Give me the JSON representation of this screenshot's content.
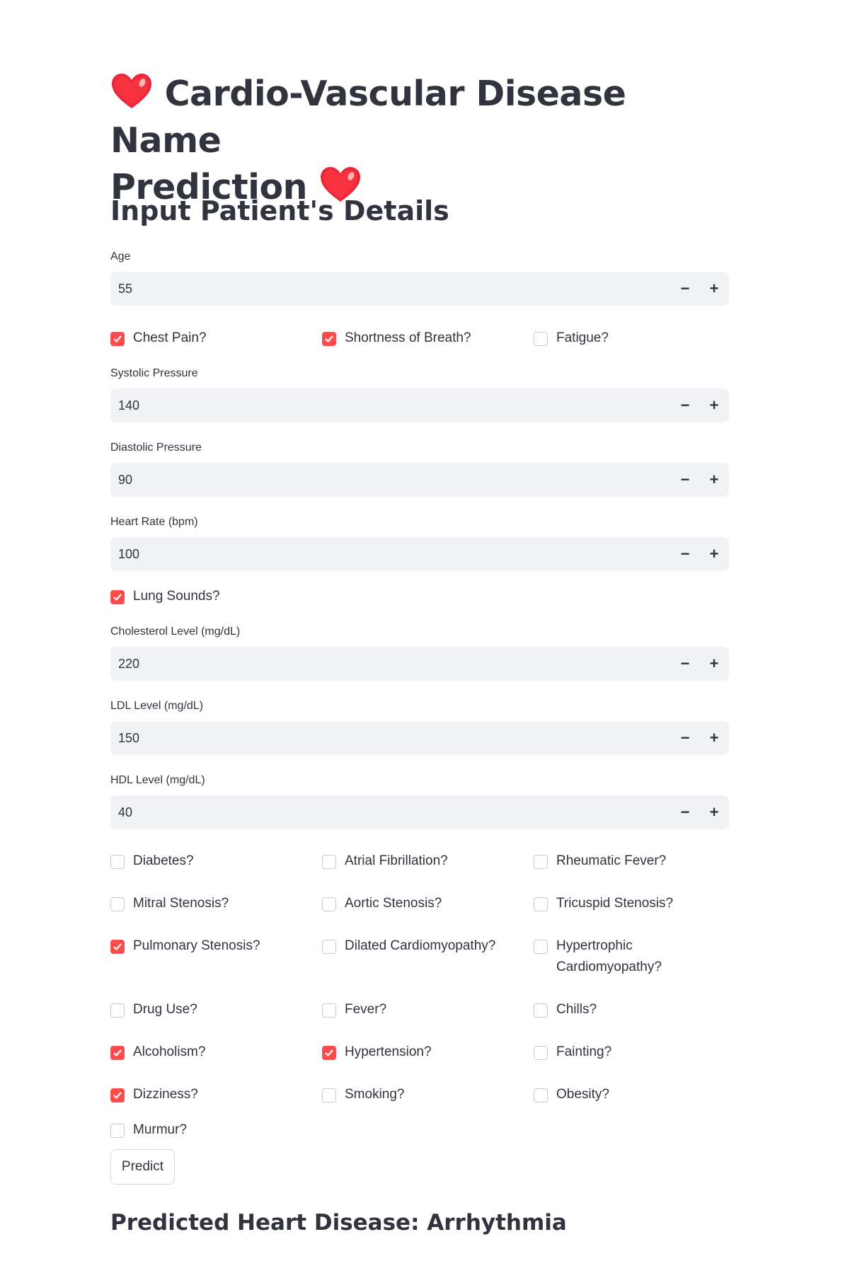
{
  "colors": {
    "accent": "#ff4b4b",
    "text": "#31333f",
    "input_bg": "#f0f2f6"
  },
  "title": {
    "line1": "Cardio-Vascular Disease Name",
    "line2": "Prediction",
    "icon": "red-heart-emoji"
  },
  "subtitle": "Input Patient's Details",
  "inputs": {
    "age": {
      "label": "Age",
      "value": "55"
    },
    "systolic": {
      "label": "Systolic Pressure",
      "value": "140"
    },
    "diastolic": {
      "label": "Diastolic Pressure",
      "value": "90"
    },
    "heart_rate": {
      "label": "Heart Rate (bpm)",
      "value": "100"
    },
    "cholesterol": {
      "label": "Cholesterol Level (mg/dL)",
      "value": "220"
    },
    "ldl": {
      "label": "LDL Level (mg/dL)",
      "value": "150"
    },
    "hdl": {
      "label": "HDL Level (mg/dL)",
      "value": "40"
    }
  },
  "stepper": {
    "minus": "−",
    "plus": "+"
  },
  "checkboxes": {
    "chest_pain": {
      "label": "Chest Pain?",
      "checked": true
    },
    "shortness_of_breath": {
      "label": "Shortness of Breath?",
      "checked": true
    },
    "fatigue": {
      "label": "Fatigue?",
      "checked": false
    },
    "lung_sounds": {
      "label": "Lung Sounds?",
      "checked": true
    },
    "diabetes": {
      "label": "Diabetes?",
      "checked": false
    },
    "atrial_fibrillation": {
      "label": "Atrial Fibrillation?",
      "checked": false
    },
    "rheumatic_fever": {
      "label": "Rheumatic Fever?",
      "checked": false
    },
    "mitral_stenosis": {
      "label": "Mitral Stenosis?",
      "checked": false
    },
    "aortic_stenosis": {
      "label": "Aortic Stenosis?",
      "checked": false
    },
    "tricuspid_stenosis": {
      "label": "Tricuspid Stenosis?",
      "checked": false
    },
    "pulmonary_stenosis": {
      "label": "Pulmonary Stenosis?",
      "checked": true
    },
    "dilated_cardiomyopathy": {
      "label": "Dilated Cardiomyopathy?",
      "checked": false
    },
    "hypertrophic_cardiomyopathy": {
      "label": "Hypertrophic Cardiomyopathy?",
      "checked": false
    },
    "drug_use": {
      "label": "Drug Use?",
      "checked": false
    },
    "fever": {
      "label": "Fever?",
      "checked": false
    },
    "chills": {
      "label": "Chills?",
      "checked": false
    },
    "alcoholism": {
      "label": "Alcoholism?",
      "checked": true
    },
    "hypertension": {
      "label": "Hypertension?",
      "checked": true
    },
    "fainting": {
      "label": "Fainting?",
      "checked": false
    },
    "dizziness": {
      "label": "Dizziness?",
      "checked": true
    },
    "smoking": {
      "label": "Smoking?",
      "checked": false
    },
    "obesity": {
      "label": "Obesity?",
      "checked": false
    },
    "murmur": {
      "label": "Murmur?",
      "checked": false
    }
  },
  "predict_button": "Predict",
  "result": "Predicted Heart Disease: Arrhythmia"
}
